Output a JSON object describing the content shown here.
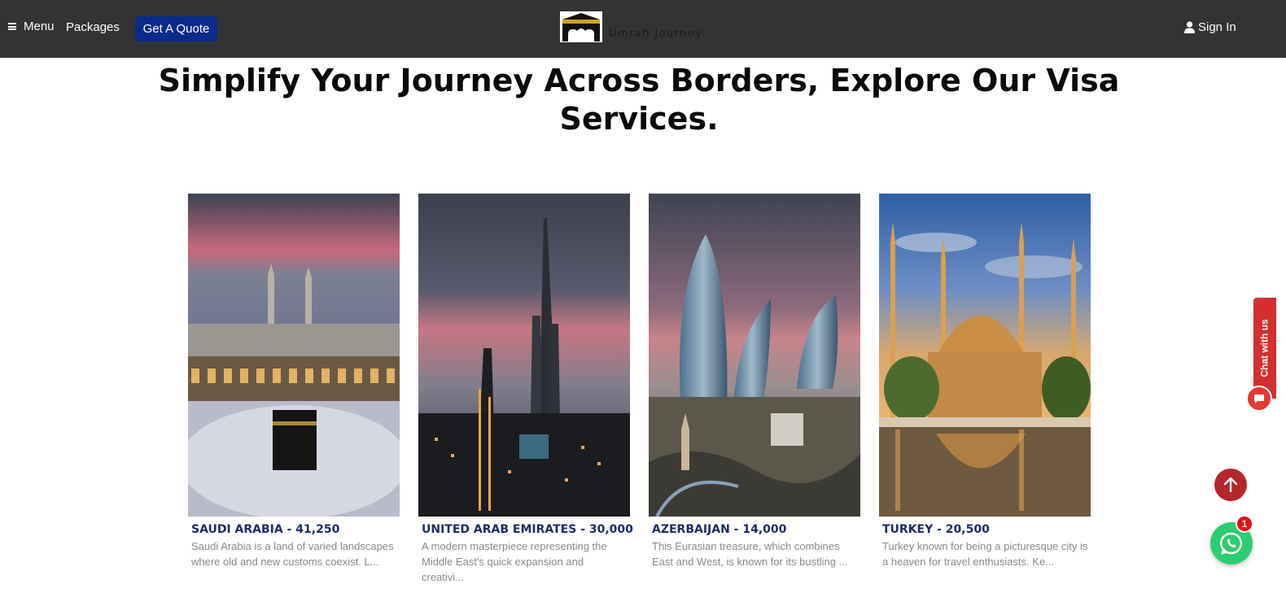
{
  "nav": {
    "menu_label": "Menu",
    "packages_label": "Packages",
    "quote_label": "Get A Quote",
    "logo_text": "Umrah Journey",
    "signin_label": "Sign In"
  },
  "heading": {
    "line1": "Simplify Your Journey Across Borders, Explore Our Visa",
    "line2": "Services."
  },
  "cards": [
    {
      "title": "SAUDI ARABIA - 41,250",
      "desc": "Saudi Arabia is a land of varied landscapes where old and new customs coexist. L..."
    },
    {
      "title": "UNITED ARAB EMIRATES - 30,000",
      "desc": "A modern masterpiece representing the Middle East's quick expansion and creativi..."
    },
    {
      "title": "AZERBAIJAN - 14,000",
      "desc": "This Eurasian treasure, which combines East and West, is known for its bustling ..."
    },
    {
      "title": "TURKEY - 20,500",
      "desc": "Turkey known for being a picturesque city is a heaven for travel enthusiasts. Ke..."
    }
  ],
  "chat": {
    "tab_label": "Chat with us"
  },
  "whatsapp": {
    "badge_count": "1"
  },
  "colors": {
    "navbar_bg": "#333333",
    "quote_button_bg": "#0b2a8c",
    "card_title": "#1b2d6b",
    "chat_red": "#d32f2f",
    "whatsapp_green": "#2ecc71"
  }
}
